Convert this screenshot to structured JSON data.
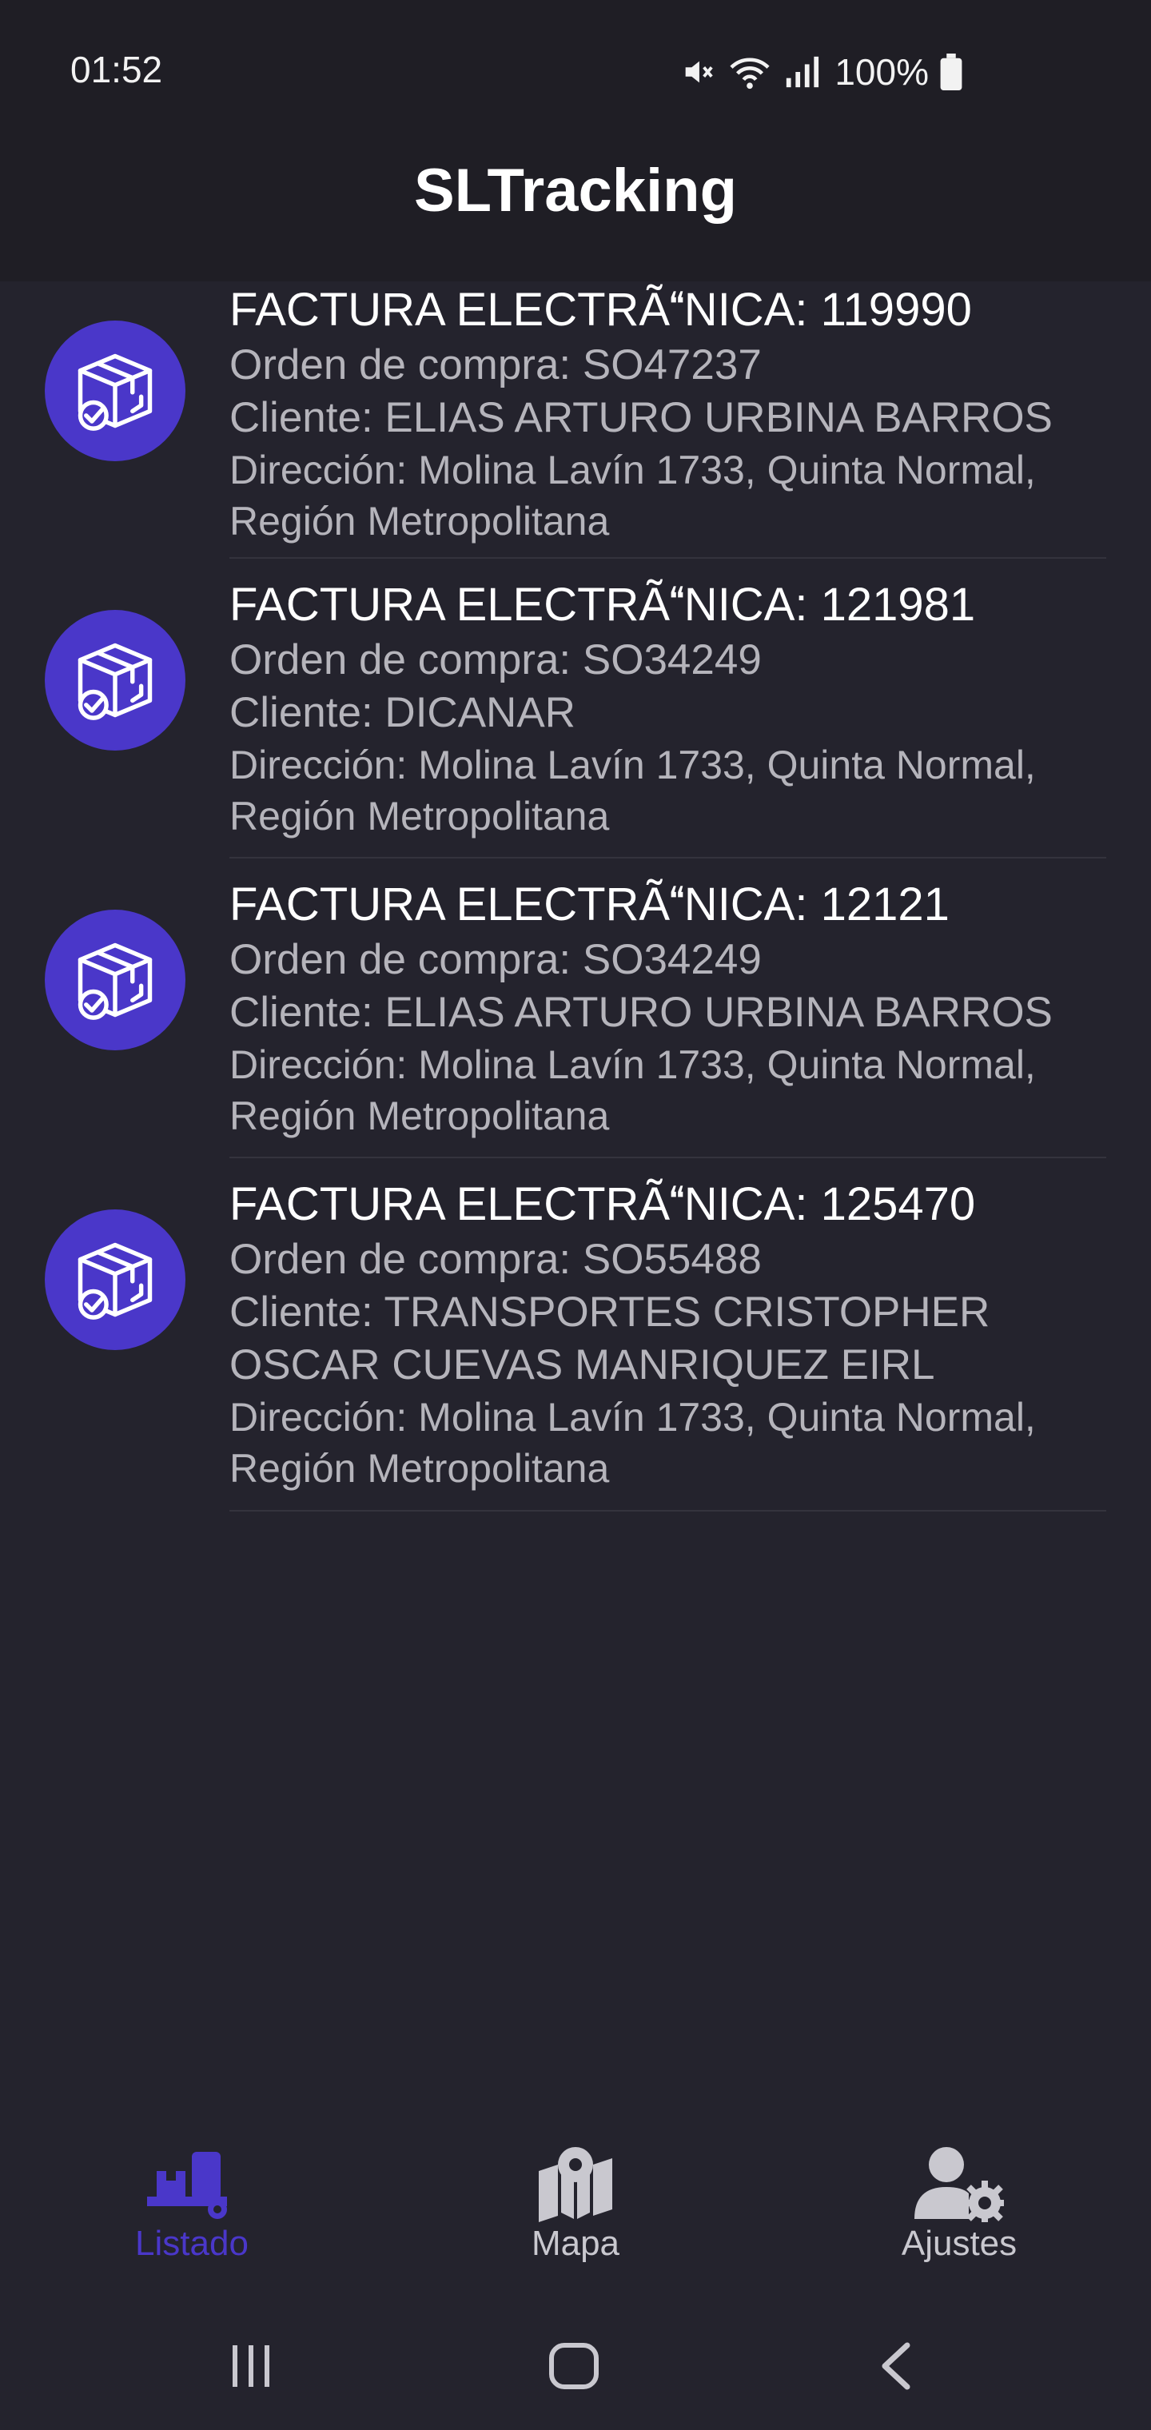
{
  "status_bar": {
    "time": "01:52",
    "battery": "100%",
    "icons": [
      "mute-icon",
      "wifi-icon",
      "signal-icon",
      "battery-icon"
    ]
  },
  "app": {
    "title": "SLTracking"
  },
  "items": [
    {
      "title": "FACTURA ELECTRÃNICA: 119990",
      "order": "Orden de compra: SO47237",
      "client": "Cliente: ELIAS ARTURO URBINA BARROS",
      "address_1": "Dirección: Molina Lavín 1733, Quinta Normal,",
      "address_2": "Región Metropolitana"
    },
    {
      "title": "FACTURA ELECTRÃNICA: 121981",
      "order": "Orden de compra: SO34249",
      "client": "Cliente: DICANAR",
      "address_1": "Dirección: Molina Lavín 1733, Quinta Normal,",
      "address_2": "Región Metropolitana"
    },
    {
      "title": "FACTURA ELECTRÃNICA: 12121",
      "order": "Orden de compra: SO34249",
      "client": "Cliente: ELIAS ARTURO URBINA BARROS",
      "address_1": "Dirección: Molina Lavín 1733, Quinta Normal,",
      "address_2": "Región Metropolitana"
    },
    {
      "title": "FACTURA ELECTRÃNICA: 125470",
      "order": "Orden de compra: SO55488",
      "client_1": "Cliente: TRANSPORTES CRISTOPHER",
      "client_2": "OSCAR CUEVAS MANRIQUEZ EIRL",
      "address_1": "Dirección: Molina Lavín 1733, Quinta Normal,",
      "address_2": "Región Metropolitana"
    }
  ],
  "bottom_nav": {
    "listado": "Listado",
    "mapa": "Mapa",
    "ajustes": "Ajustes"
  },
  "colors": {
    "background": "#24232d",
    "accent": "#4a37c9",
    "secondary_text": "#b5b4bb"
  }
}
